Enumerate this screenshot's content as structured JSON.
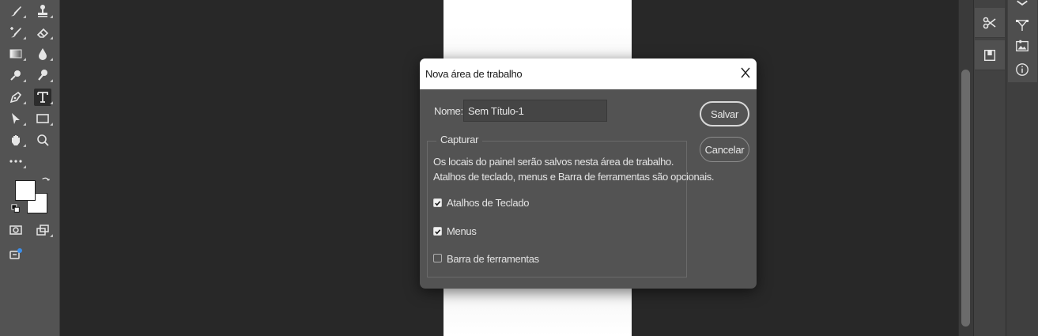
{
  "dialog": {
    "title": "Nova área de trabalho",
    "name_label": "Nome:",
    "name_value": "Sem Título-1",
    "save_label": "Salvar",
    "cancel_label": "Cancelar",
    "capture_legend": "Capturar",
    "description_line1": "Os locais do painel serão salvos nesta área de trabalho.",
    "description_line2": "Atalhos de teclado, menus e Barra de ferramentas são opcionais.",
    "options": [
      {
        "label": "Atalhos de Teclado",
        "checked": true
      },
      {
        "label": "Menus",
        "checked": true
      },
      {
        "label": "Barra de ferramentas",
        "checked": false
      }
    ]
  },
  "toolbar": {
    "tools": [
      "brush-tool",
      "clone-stamp-tool",
      "history-brush-tool",
      "eraser-tool",
      "gradient-tool",
      "blur-tool",
      "dodge-tool",
      "pen-tool",
      "type-tool",
      "path-selection-tool",
      "rectangle-tool",
      "hand-tool",
      "zoom-tool",
      "more-tools",
      "swap-colors",
      "default-colors",
      "quick-mask",
      "screen-mode",
      "content-credentials"
    ],
    "foreground_color": "#ffffff",
    "background_color": "#ffffff"
  },
  "panels": {
    "icons": [
      "scissors-icon",
      "artboard-icon",
      "layers-icon",
      "paths-icon",
      "image-icon",
      "info-icon"
    ]
  }
}
